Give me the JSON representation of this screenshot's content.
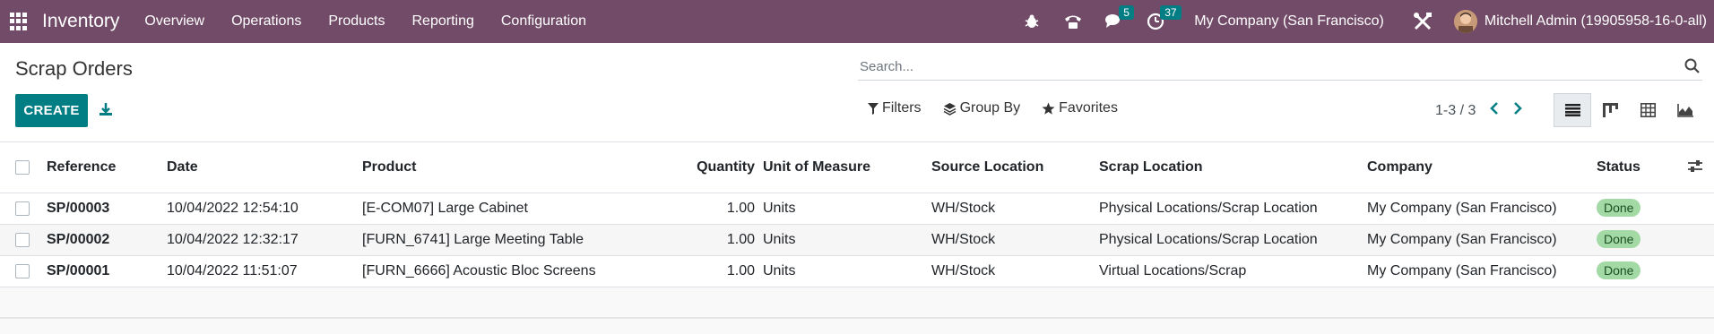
{
  "navbar": {
    "app_name": "Inventory",
    "menu": [
      "Overview",
      "Operations",
      "Products",
      "Reporting",
      "Configuration"
    ],
    "messages_count": "5",
    "activities_count": "37",
    "company": "My Company (San Francisco)",
    "user": "Mitchell Admin (19905958-16-0-all)",
    "color": "#714b67"
  },
  "control_panel": {
    "title": "Scrap Orders",
    "search_placeholder": "Search...",
    "create_label": "CREATE",
    "filters_label": "Filters",
    "group_by_label": "Group By",
    "favorites_label": "Favorites",
    "pager": "1-3 / 3",
    "accent_color": "#017e84"
  },
  "table": {
    "columns": {
      "reference": "Reference",
      "date": "Date",
      "product": "Product",
      "quantity": "Quantity",
      "uom": "Unit of Measure",
      "source": "Source Location",
      "scrap": "Scrap Location",
      "company": "Company",
      "status": "Status"
    },
    "rows": [
      {
        "reference": "SP/00003",
        "date": "10/04/2022 12:54:10",
        "product": "[E-COM07] Large Cabinet",
        "quantity": "1.00",
        "uom": "Units",
        "source": "WH/Stock",
        "scrap": "Physical Locations/Scrap Location",
        "company": "My Company (San Francisco)",
        "status": "Done"
      },
      {
        "reference": "SP/00002",
        "date": "10/04/2022 12:32:17",
        "product": "[FURN_6741] Large Meeting Table",
        "quantity": "1.00",
        "uom": "Units",
        "source": "WH/Stock",
        "scrap": "Physical Locations/Scrap Location",
        "company": "My Company (San Francisco)",
        "status": "Done"
      },
      {
        "reference": "SP/00001",
        "date": "10/04/2022 11:51:07",
        "product": "[FURN_6666] Acoustic Bloc Screens",
        "quantity": "1.00",
        "uom": "Units",
        "source": "WH/Stock",
        "scrap": "Virtual Locations/Scrap",
        "company": "My Company (San Francisco)",
        "status": "Done"
      }
    ],
    "status_color": "#a3d9a5"
  }
}
